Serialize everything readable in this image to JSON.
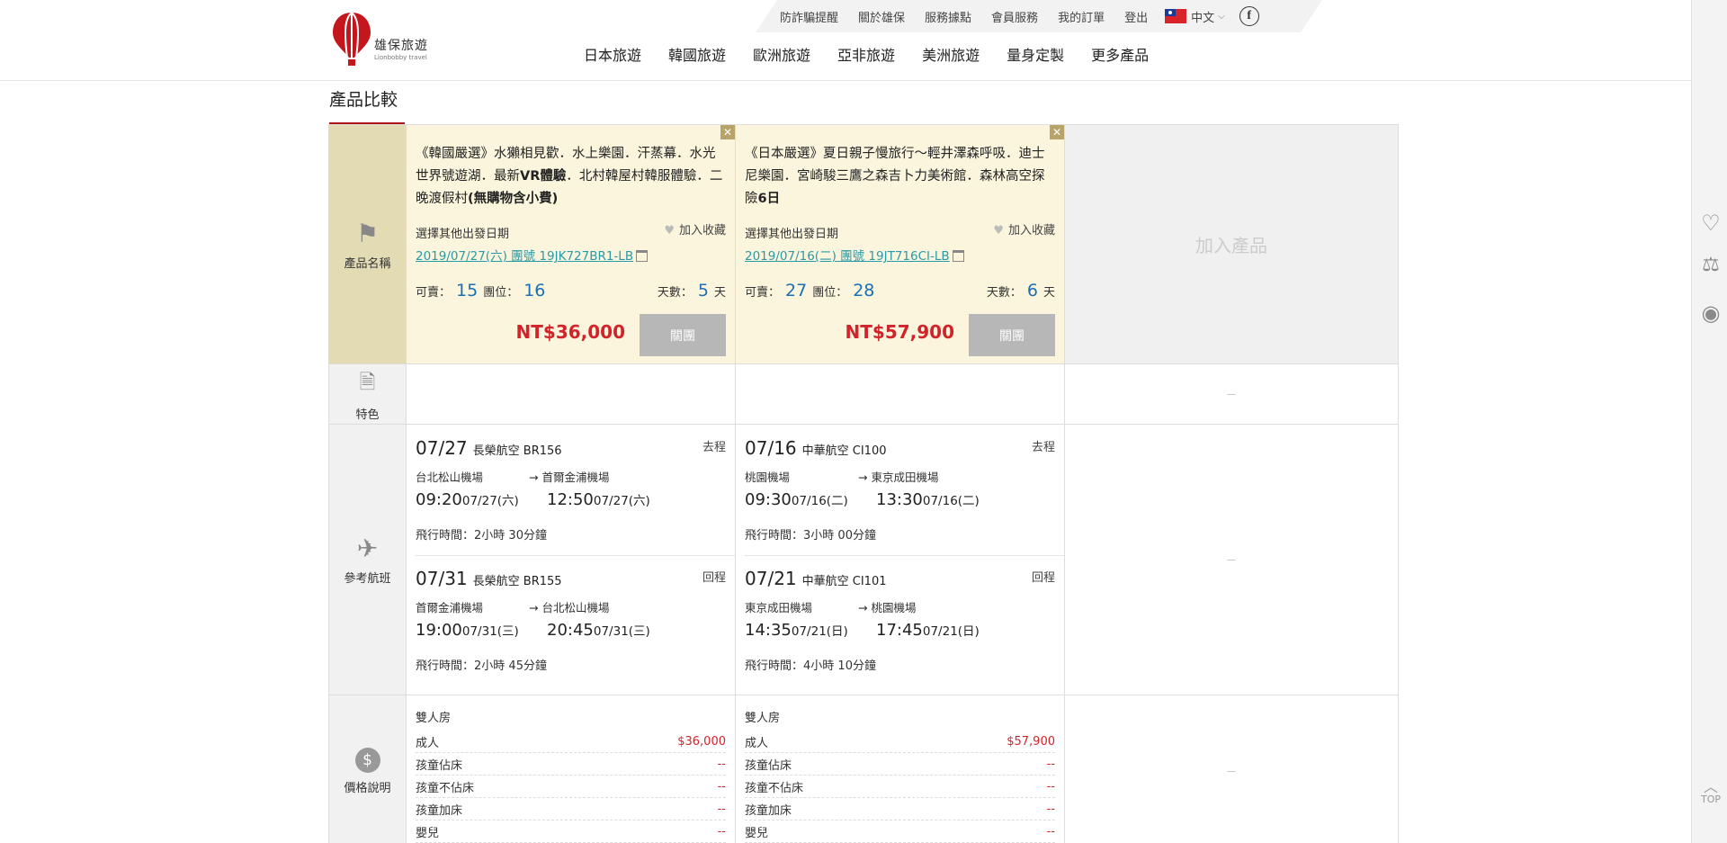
{
  "header": {
    "logo_zh": "雄保旅遊",
    "logo_en": "Lionbobby travel",
    "toplinks": [
      "防詐騙提醒",
      "關於雄保",
      "服務據點",
      "會員服務",
      "我的訂單",
      "登出"
    ],
    "language": "中文",
    "facebook": "f",
    "nav": [
      "日本旅遊",
      "韓國旅遊",
      "歐洲旅遊",
      "亞非旅遊",
      "美洲旅遊",
      "量身定製",
      "更多產品"
    ]
  },
  "page_title": "產品比較",
  "labels": {
    "product_name": "產品名稱",
    "feature": "特色",
    "flight": "參考航班",
    "price": "價格說明",
    "other_date": "選擇其他出發日期",
    "favorite": "加入收藏",
    "available": "可賣：",
    "seats": "團位：",
    "days": "天數：",
    "day_unit": "天",
    "close_group": "關團",
    "add_product": "加入產品",
    "flight_time_prefix": "飛行時間：",
    "dash": "－",
    "room_type": "雙人房"
  },
  "products": [
    {
      "title_parts": [
        "《韓國嚴選》水獺相見歡．水上樂園．汗蒸幕．水光世界號遊湖．最新",
        "VR體驗",
        "．北村韓屋村韓服體驗．二晚渡假村",
        "(無購物含小費)"
      ],
      "date_link": "2019/07/27(六) 團號 19JK727BR1-LB",
      "available": "15",
      "seats": "16",
      "days": "5",
      "price": "NT$36,000",
      "outbound": {
        "date": "07/27",
        "airline": "長榮航空 BR156",
        "dir": "去程",
        "from": "台北松山機場",
        "to": "→ 首爾金浦機場",
        "dep_time": "09:20",
        "dep_date": "07/27(六)",
        "arr_time": "12:50",
        "arr_date": "07/27(六)",
        "duration": "2小時 30分鐘"
      },
      "inbound": {
        "date": "07/31",
        "airline": "長榮航空 BR155",
        "dir": "回程",
        "from": "首爾金浦機場",
        "to": "→ 台北松山機場",
        "dep_time": "19:00",
        "dep_date": "07/31(三)",
        "arr_time": "20:45",
        "arr_date": "07/31(三)",
        "duration": "2小時 45分鐘"
      },
      "prices": [
        {
          "label": "成人",
          "value": "$36,000"
        },
        {
          "label": "孩童佔床",
          "value": "--"
        },
        {
          "label": "孩童不佔床",
          "value": "--"
        },
        {
          "label": "孩童加床",
          "value": "--"
        },
        {
          "label": "嬰兒",
          "value": "--"
        }
      ]
    },
    {
      "title_parts": [
        "《日本嚴選》夏日親子慢旅行～輕井澤森呼吸．迪士尼樂園．宮崎駿三鷹之森吉卜力美術館．森林高空探險",
        "6日",
        "",
        ""
      ],
      "date_link": "2019/07/16(二) 團號 19JT716CI-LB",
      "available": "27",
      "seats": "28",
      "days": "6",
      "price": "NT$57,900",
      "outbound": {
        "date": "07/16",
        "airline": "中華航空 CI100",
        "dir": "去程",
        "from": "桃園機場",
        "to": "→ 東京成田機場",
        "dep_time": "09:30",
        "dep_date": "07/16(二)",
        "arr_time": "13:30",
        "arr_date": "07/16(二)",
        "duration": "3小時 00分鐘"
      },
      "inbound": {
        "date": "07/21",
        "airline": "中華航空 CI101",
        "dir": "回程",
        "from": "東京成田機場",
        "to": "→ 桃園機場",
        "dep_time": "14:35",
        "dep_date": "07/21(日)",
        "arr_time": "17:45",
        "arr_date": "07/21(日)",
        "duration": "4小時 10分鐘"
      },
      "prices": [
        {
          "label": "成人",
          "value": "$57,900"
        },
        {
          "label": "孩童佔床",
          "value": "--"
        },
        {
          "label": "孩童不佔床",
          "value": "--"
        },
        {
          "label": "孩童加床",
          "value": "--"
        },
        {
          "label": "嬰兒",
          "value": "--"
        }
      ]
    }
  ],
  "siderail": {
    "top_label": "TOP"
  },
  "colors": {
    "brand_red": "#b0151a",
    "price_red": "#d2232a",
    "link_teal": "#2a9aa8",
    "num_blue": "#1a6fb5"
  }
}
